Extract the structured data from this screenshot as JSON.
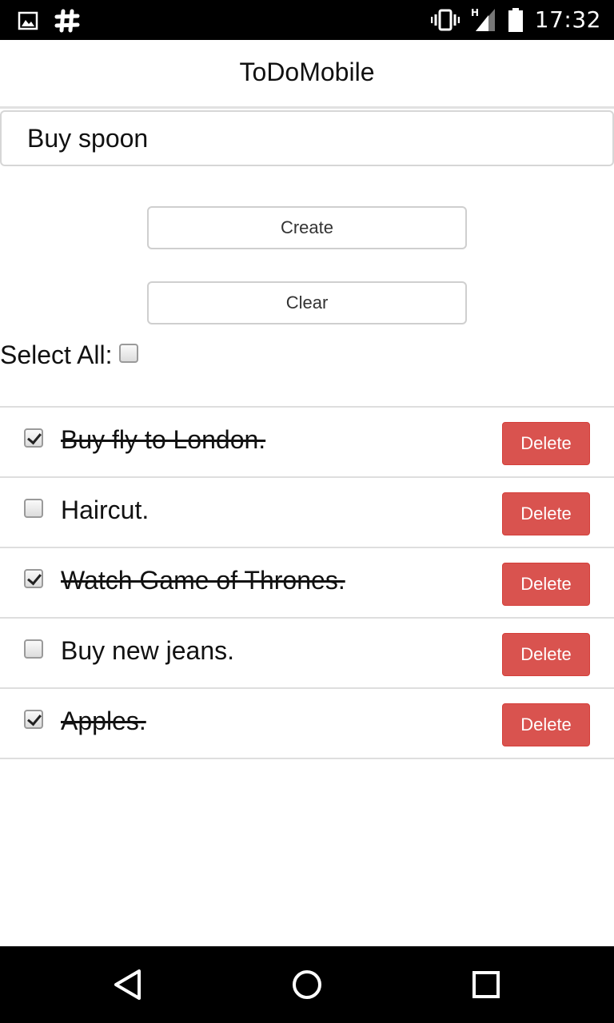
{
  "status_bar": {
    "time": "17:32",
    "network_label": "H",
    "icons": [
      "image-icon",
      "slack-icon",
      "vibrate-icon",
      "signal-icon",
      "battery-icon"
    ]
  },
  "app": {
    "title": "ToDoMobile"
  },
  "new_todo": {
    "value": "Buy spoon"
  },
  "buttons": {
    "create": "Create",
    "clear": "Clear"
  },
  "select_all": {
    "label": "Select All:",
    "checked": false
  },
  "todos": [
    {
      "text": "Buy fly to London.",
      "done": true,
      "delete_label": "Delete"
    },
    {
      "text": "Haircut.",
      "done": false,
      "delete_label": "Delete"
    },
    {
      "text": "Watch Game of Thrones.",
      "done": true,
      "delete_label": "Delete"
    },
    {
      "text": "Buy new jeans.",
      "done": false,
      "delete_label": "Delete"
    },
    {
      "text": "Apples.",
      "done": true,
      "delete_label": "Delete"
    }
  ],
  "colors": {
    "delete_button": "#d9534f",
    "status_bar": "#000000",
    "nav_bar": "#000000"
  },
  "nav_bar": {
    "icons": [
      "back-icon",
      "home-icon",
      "recents-icon"
    ]
  }
}
